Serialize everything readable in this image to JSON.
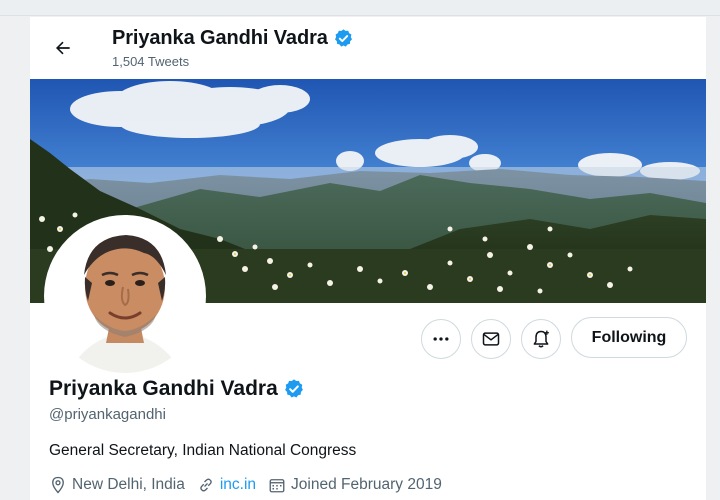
{
  "header": {
    "name": "Priyanka Gandhi Vadra",
    "tweet_count": "1,504 Tweets"
  },
  "profile": {
    "name": "Priyanka Gandhi Vadra",
    "handle": "@priyankagandhi",
    "bio": "General Secretary, Indian National Congress",
    "location": "New Delhi, India",
    "website": "inc.in",
    "joined": "Joined February 2019"
  },
  "actions": {
    "follow_label": "Following"
  },
  "colors": {
    "accent": "#1d9bf0",
    "text": "#0f1419",
    "muted": "#536471",
    "border": "#cfd9de"
  },
  "icons": [
    "back-arrow-icon",
    "verified-badge-icon",
    "more-icon",
    "message-icon",
    "notification-bell-icon",
    "location-icon",
    "link-icon",
    "calendar-icon"
  ]
}
